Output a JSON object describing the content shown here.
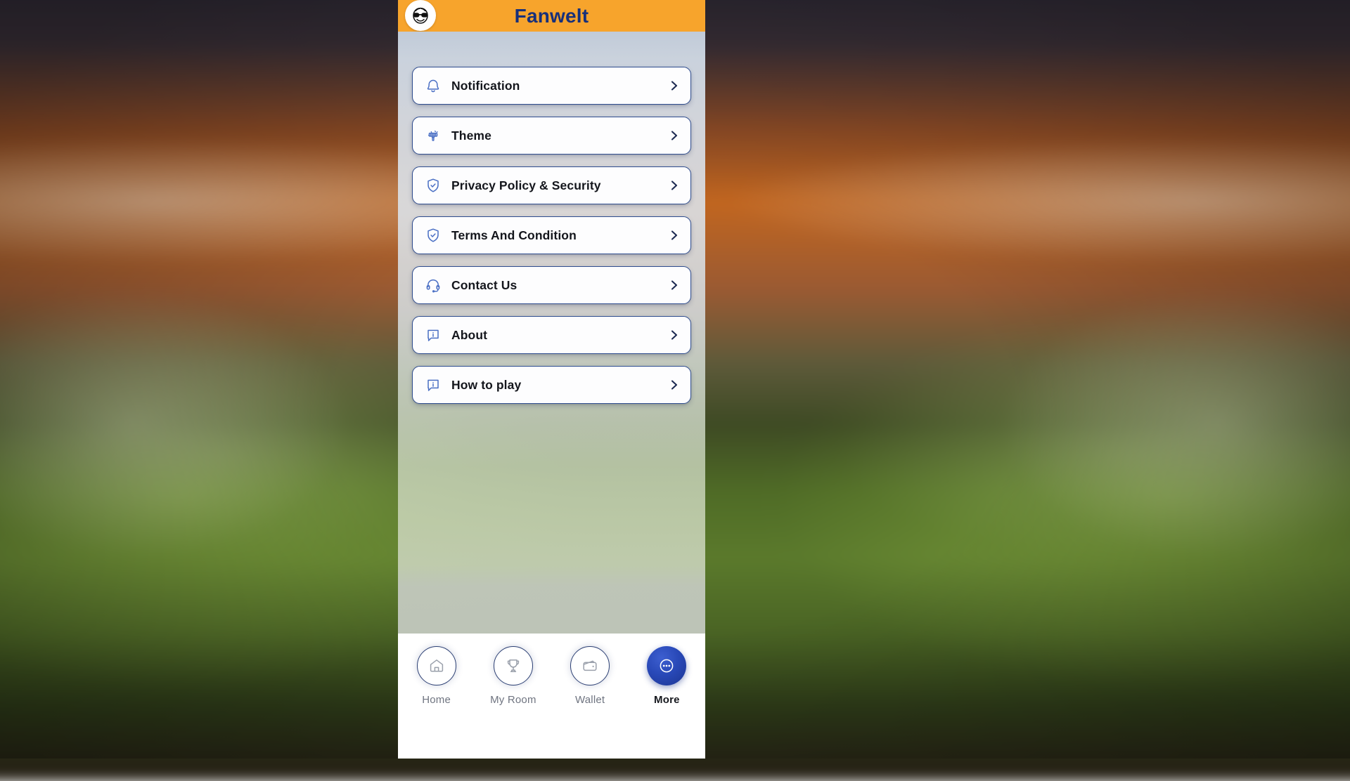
{
  "header": {
    "title": "Fanwelt",
    "logo_icon": "sunglasses-face-logo-icon",
    "background_color": "#f7a42c",
    "title_color": "#18307a"
  },
  "menu": {
    "items": [
      {
        "label": "Notification",
        "icon": "bell-icon",
        "chevron": "chevron-right-icon"
      },
      {
        "label": "Theme",
        "icon": "paintbrush-icon",
        "chevron": "chevron-right-icon"
      },
      {
        "label": "Privacy Policy & Security",
        "icon": "shield-check-icon",
        "chevron": "chevron-right-icon"
      },
      {
        "label": "Terms And Condition",
        "icon": "shield-check-icon",
        "chevron": "chevron-right-icon"
      },
      {
        "label": "Contact Us",
        "icon": "headset-icon",
        "chevron": "chevron-right-icon"
      },
      {
        "label": "About",
        "icon": "info-bubble-icon",
        "chevron": "chevron-right-icon"
      },
      {
        "label": "How to play",
        "icon": "info-bubble-icon",
        "chevron": "chevron-right-icon"
      }
    ],
    "card_border_color": "#2f4d8f",
    "icon_color": "#4a6fc4"
  },
  "bottom_nav": {
    "items": [
      {
        "label": "Home",
        "icon": "home-icon",
        "active": false
      },
      {
        "label": "My Room",
        "icon": "trophy-icon",
        "active": false
      },
      {
        "label": "Wallet",
        "icon": "wallet-icon",
        "active": false
      },
      {
        "label": "More",
        "icon": "more-dots-icon",
        "active": true
      }
    ],
    "active_color": "#1c3592",
    "inactive_color": "#6f7480"
  }
}
